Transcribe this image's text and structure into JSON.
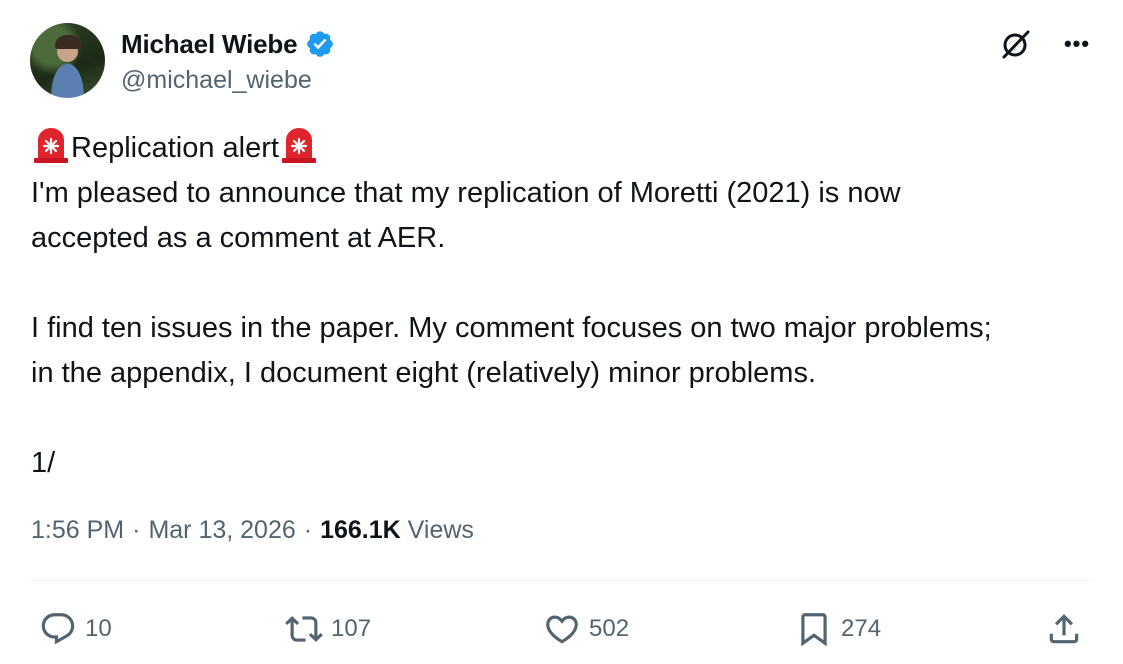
{
  "author": {
    "name": "Michael Wiebe",
    "handle": "@michael_wiebe",
    "verified": true
  },
  "top_icons": [
    "grok-icon",
    "more-icon"
  ],
  "tweet": {
    "line1": "Replication alert",
    "line2": "I'm pleased to announce that my replication of Moretti (2021) is now",
    "line3": "accepted as a comment at AER.",
    "line4": "I find ten issues in the paper. My comment focuses on two major problems;",
    "line5": "in the appendix, I document eight (relatively) minor problems.",
    "line6": "1/",
    "emoji": "police-car-light-emoji"
  },
  "meta": {
    "time": "1:56 PM",
    "sep1": "·",
    "date": "Mar 13, 2026",
    "sep2": "·",
    "views_count": "166.1K",
    "views_label": "Views"
  },
  "actions": {
    "replies": "10",
    "reposts": "107",
    "likes": "502",
    "bookmarks": "274"
  },
  "colors": {
    "text": "#0f1419",
    "secondary": "#536471",
    "verified": "#1d9bf0",
    "siren": "#e0242e"
  }
}
